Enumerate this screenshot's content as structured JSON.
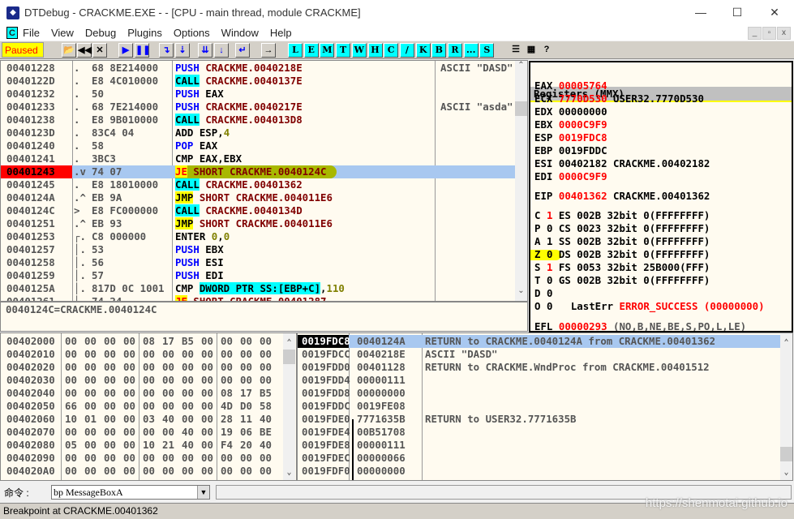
{
  "window": {
    "title": "DTDebug - CRACKME.EXE - - [CPU - main thread, module CRACKME]",
    "minimize": "—",
    "maximize": "☐",
    "close": "✕"
  },
  "menu": {
    "app_icon": "C",
    "items": [
      "File",
      "View",
      "Debug",
      "Plugins",
      "Options",
      "Window",
      "Help"
    ],
    "mdi": [
      "_",
      "▫",
      "x"
    ]
  },
  "toolbar": {
    "status": "Paused",
    "status_color": "#ffff00",
    "icon_buttons": [
      {
        "name": "open-icon",
        "glyph": "📂"
      },
      {
        "name": "restart-icon",
        "glyph": "◀◀"
      },
      {
        "name": "close-icon",
        "glyph": "✕"
      },
      {
        "name": "run-icon",
        "glyph": "▶"
      },
      {
        "name": "pause-icon",
        "glyph": "❚❚"
      },
      {
        "name": "step-into-icon",
        "glyph": "↴"
      },
      {
        "name": "step-over-icon",
        "glyph": "⇣"
      },
      {
        "name": "trace-into-icon",
        "glyph": "⇊"
      },
      {
        "name": "trace-over-icon",
        "glyph": "↓"
      },
      {
        "name": "execute-till-return-icon",
        "glyph": "↵"
      },
      {
        "name": "goto-icon",
        "glyph": "→"
      }
    ],
    "letter_buttons": [
      "L",
      "E",
      "M",
      "T",
      "W",
      "H",
      "C",
      "/",
      "K",
      "B",
      "R",
      "...",
      "S"
    ],
    "extra_buttons": [
      {
        "name": "list-icon",
        "glyph": "☰"
      },
      {
        "name": "colors-icon",
        "glyph": "▦"
      },
      {
        "name": "help-icon",
        "glyph": "?"
      }
    ]
  },
  "disasm": {
    "rows": [
      {
        "addr": "00401228",
        "mark": ".",
        "hex": "68 8E214000",
        "ins": [
          [
            "PUSH",
            "blue"
          ],
          [
            " "
          ],
          [
            "CRACKME.0040218E",
            "dred"
          ]
        ],
        "comment": "ASCII \"DASD\""
      },
      {
        "addr": "0040122D",
        "mark": ".",
        "hex": "E8 4C010000",
        "ins": [
          [
            "CALL",
            "bcy"
          ],
          [
            " "
          ],
          [
            "CRACKME.0040137E",
            "dred"
          ]
        ],
        "comment": ""
      },
      {
        "addr": "00401232",
        "mark": ".",
        "hex": "50",
        "ins": [
          [
            "PUSH",
            "blue"
          ],
          [
            " EAX"
          ]
        ],
        "comment": ""
      },
      {
        "addr": "00401233",
        "mark": ".",
        "hex": "68 7E214000",
        "ins": [
          [
            "PUSH",
            "blue"
          ],
          [
            " "
          ],
          [
            "CRACKME.0040217E",
            "dred"
          ]
        ],
        "comment": "ASCII \"asda\""
      },
      {
        "addr": "00401238",
        "mark": ".",
        "hex": "E8 9B010000",
        "ins": [
          [
            "CALL",
            "bcy"
          ],
          [
            " "
          ],
          [
            "CRACKME.004013D8",
            "dred"
          ]
        ],
        "comment": ""
      },
      {
        "addr": "0040123D",
        "mark": ".",
        "hex": "83C4 04",
        "ins": [
          [
            "ADD ESP,"
          ],
          [
            "4",
            "olive"
          ]
        ],
        "comment": ""
      },
      {
        "addr": "00401240",
        "mark": ".",
        "hex": "58",
        "ins": [
          [
            "POP",
            "blue"
          ],
          [
            " EAX"
          ]
        ],
        "comment": ""
      },
      {
        "addr": "00401241",
        "mark": ".",
        "hex": "3BC3",
        "ins": [
          [
            "CMP EAX,EBX"
          ]
        ],
        "comment": ""
      },
      {
        "addr": "00401243",
        "mark": ".v",
        "hex": "74 07",
        "ins": [
          [
            "JE",
            "bye red"
          ],
          [
            " "
          ],
          [
            "SHORT CRACKME.0040124C",
            "dred"
          ]
        ],
        "comment": "",
        "selected": true
      },
      {
        "addr": "00401245",
        "mark": ".",
        "hex": "E8 18010000",
        "ins": [
          [
            "CALL",
            "bcy"
          ],
          [
            " "
          ],
          [
            "CRACKME.00401362",
            "dred"
          ]
        ],
        "comment": ""
      },
      {
        "addr": "0040124A",
        "mark": ".^",
        "hex": "EB 9A",
        "ins": [
          [
            "JMP",
            "bye"
          ],
          [
            " "
          ],
          [
            "SHORT CRACKME.004011E6",
            "dred"
          ]
        ],
        "comment": ""
      },
      {
        "addr": "0040124C",
        "mark": "> ",
        "hex": "E8 FC000000",
        "ins": [
          [
            "CALL",
            "bcy"
          ],
          [
            " "
          ],
          [
            "CRACKME.0040134D",
            "dred"
          ]
        ],
        "comment": ""
      },
      {
        "addr": "00401251",
        "mark": ".^",
        "hex": "EB 93",
        "ins": [
          [
            "JMP",
            "bye"
          ],
          [
            " "
          ],
          [
            "SHORT CRACKME.004011E6",
            "dred"
          ]
        ],
        "comment": ""
      },
      {
        "addr": "00401253",
        "mark": "┌.",
        "hex": "C8 000000",
        "ins": [
          [
            "ENTER "
          ],
          [
            "0",
            "olive"
          ],
          [
            ","
          ],
          [
            "0",
            "olive"
          ]
        ],
        "comment": ""
      },
      {
        "addr": "00401257",
        "mark": "│.",
        "hex": "53",
        "ins": [
          [
            "PUSH",
            "blue"
          ],
          [
            " EBX"
          ]
        ],
        "comment": ""
      },
      {
        "addr": "00401258",
        "mark": "│.",
        "hex": "56",
        "ins": [
          [
            "PUSH",
            "blue"
          ],
          [
            " ESI"
          ]
        ],
        "comment": ""
      },
      {
        "addr": "00401259",
        "mark": "│.",
        "hex": "57",
        "ins": [
          [
            "PUSH",
            "blue"
          ],
          [
            " EDI"
          ]
        ],
        "comment": ""
      },
      {
        "addr": "0040125A",
        "mark": "│.",
        "hex": "817D 0C 1001",
        "ins": [
          [
            "CMP "
          ],
          [
            "DWORD PTR SS:[EBP+C]",
            "bcy blue"
          ],
          [
            ","
          ],
          [
            "110",
            "olive"
          ]
        ],
        "comment": ""
      },
      {
        "addr": "00401261",
        "mark": "│.",
        "hex": "74 24",
        "ins": [
          [
            "JE",
            "bye red"
          ],
          [
            " "
          ],
          [
            "SHORT CRACKME.00401287",
            "dred"
          ]
        ],
        "comment": ""
      }
    ],
    "info": "0040124C=CRACKME.0040124C"
  },
  "registers": {
    "title": "Registers (MMX)",
    "gp": [
      {
        "name": "EAX",
        "value": "00005764",
        "changed": true,
        "note": ""
      },
      {
        "name": "ECX",
        "value": "7770D530",
        "changed": true,
        "note": "USER32.7770D530"
      },
      {
        "name": "EDX",
        "value": "00000000",
        "changed": false,
        "note": ""
      },
      {
        "name": "EBX",
        "value": "0000C9F9",
        "changed": true,
        "note": ""
      },
      {
        "name": "ESP",
        "value": "0019FDC8",
        "changed": true,
        "note": ""
      },
      {
        "name": "EBP",
        "value": "0019FDDC",
        "changed": false,
        "note": ""
      },
      {
        "name": "ESI",
        "value": "00402182",
        "changed": false,
        "note": "CRACKME.00402182"
      },
      {
        "name": "EDI",
        "value": "0000C9F9",
        "changed": true,
        "note": ""
      }
    ],
    "eip": {
      "name": "EIP",
      "value": "00401362",
      "note": "CRACKME.00401362"
    },
    "flags": [
      {
        "f": "C",
        "v": "1",
        "changed": true,
        "seg": "ES 002B 32bit 0(FFFFFFFF)"
      },
      {
        "f": "P",
        "v": "0",
        "changed": false,
        "seg": "CS 0023 32bit 0(FFFFFFFF)"
      },
      {
        "f": "A",
        "v": "1",
        "changed": false,
        "seg": "SS 002B 32bit 0(FFFFFFFF)"
      },
      {
        "f": "Z",
        "v": "0",
        "changed": false,
        "seg": "DS 002B 32bit 0(FFFFFFFF)",
        "highlight": true
      },
      {
        "f": "S",
        "v": "1",
        "changed": true,
        "seg": "FS 0053 32bit 25B000(FFF)"
      },
      {
        "f": "T",
        "v": "0",
        "changed": false,
        "seg": "GS 002B 32bit 0(FFFFFFFF)"
      },
      {
        "f": "D",
        "v": "0",
        "changed": false,
        "seg": ""
      },
      {
        "f": "O",
        "v": "0",
        "changed": false,
        "seg": ""
      }
    ],
    "lasterr_label": "LastErr",
    "lasterr_value": "ERROR_SUCCESS (00000000)",
    "efl": {
      "name": "EFL",
      "value": "00000293",
      "note": "(NO,B,NE,BE,S,PO,L,LE)"
    }
  },
  "dump": {
    "rows": [
      {
        "addr": "00402000",
        "bytes": [
          "00",
          "00",
          "00",
          "00",
          "08",
          "17",
          "B5",
          "00",
          "00",
          "00",
          "00"
        ]
      },
      {
        "addr": "00402010",
        "bytes": [
          "00",
          "00",
          "00",
          "00",
          "00",
          "00",
          "00",
          "00",
          "00",
          "00",
          "00"
        ]
      },
      {
        "addr": "00402020",
        "bytes": [
          "00",
          "00",
          "00",
          "00",
          "00",
          "00",
          "00",
          "00",
          "00",
          "00",
          "00"
        ]
      },
      {
        "addr": "00402030",
        "bytes": [
          "00",
          "00",
          "00",
          "00",
          "00",
          "00",
          "00",
          "00",
          "00",
          "00",
          "00"
        ]
      },
      {
        "addr": "00402040",
        "bytes": [
          "00",
          "00",
          "00",
          "00",
          "00",
          "00",
          "00",
          "00",
          "08",
          "17",
          "B5"
        ]
      },
      {
        "addr": "00402050",
        "bytes": [
          "66",
          "00",
          "00",
          "00",
          "00",
          "00",
          "00",
          "00",
          "4D",
          "D0",
          "58"
        ]
      },
      {
        "addr": "00402060",
        "bytes": [
          "10",
          "01",
          "00",
          "00",
          "03",
          "40",
          "00",
          "00",
          "28",
          "11",
          "40"
        ]
      },
      {
        "addr": "00402070",
        "bytes": [
          "00",
          "00",
          "00",
          "00",
          "00",
          "00",
          "40",
          "00",
          "19",
          "06",
          "BE"
        ]
      },
      {
        "addr": "00402080",
        "bytes": [
          "05",
          "00",
          "00",
          "00",
          "10",
          "21",
          "40",
          "00",
          "F4",
          "20",
          "40"
        ]
      },
      {
        "addr": "00402090",
        "bytes": [
          "00",
          "00",
          "00",
          "00",
          "00",
          "00",
          "00",
          "00",
          "00",
          "00",
          "00"
        ]
      },
      {
        "addr": "004020A0",
        "bytes": [
          "00",
          "00",
          "00",
          "00",
          "00",
          "00",
          "00",
          "00",
          "00",
          "00",
          "00"
        ]
      }
    ]
  },
  "stack": {
    "rows": [
      {
        "addr": "0019FDC8",
        "value": "0040124A",
        "comment": "RETURN to CRACKME.0040124A from CRACKME.00401362",
        "selected": true
      },
      {
        "addr": "0019FDCC",
        "value": "0040218E",
        "comment": "ASCII \"DASD\""
      },
      {
        "addr": "0019FDD0",
        "value": "00401128",
        "comment": "RETURN to CRACKME.WndProc from CRACKME.00401512"
      },
      {
        "addr": "0019FDD4",
        "value": "00000111",
        "comment": ""
      },
      {
        "addr": "0019FDD8",
        "value": "00000000",
        "comment": ""
      },
      {
        "addr": "0019FDDC",
        "value": "0019FE08",
        "comment": ""
      },
      {
        "addr": "0019FDE0",
        "value": "7771635B",
        "comment": "RETURN to USER32.7771635B"
      },
      {
        "addr": "0019FDE4",
        "value": "00B51708",
        "comment": ""
      },
      {
        "addr": "0019FDE8",
        "value": "00000111",
        "comment": ""
      },
      {
        "addr": "0019FDEC",
        "value": "00000066",
        "comment": ""
      },
      {
        "addr": "0019FDF0",
        "value": "00000000",
        "comment": ""
      }
    ]
  },
  "command": {
    "label": "命令 :",
    "value": "bp MessageBoxA"
  },
  "status": {
    "text": "Breakpoint at CRACKME.00401362"
  },
  "watermark": "https://shenmotai.github.io"
}
